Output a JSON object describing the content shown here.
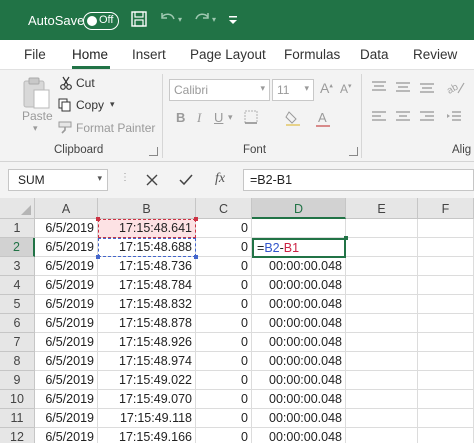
{
  "titlebar": {
    "autosave_label": "AutoSave",
    "autosave_state": "Off",
    "icons": [
      "save-icon",
      "undo-icon",
      "redo-icon",
      "customize-toolbar-icon"
    ],
    "color": "#217346"
  },
  "menu": {
    "tabs": [
      "File",
      "Home",
      "Insert",
      "Page Layout",
      "Formulas",
      "Data",
      "Review"
    ],
    "active": "Home"
  },
  "ribbon": {
    "clipboard": {
      "paste_label": "Paste",
      "cut_label": "Cut",
      "copy_label": "Copy",
      "format_painter_label": "Format Painter",
      "group_label": "Clipboard"
    },
    "font": {
      "font_name": "Calibri",
      "font_size": "11",
      "group_label": "Font"
    },
    "alignment": {
      "group_label": "Alig"
    }
  },
  "formula_bar": {
    "name_box": "SUM",
    "cancel_icon": "close-icon",
    "enter_icon": "check-icon",
    "function_label": "fx",
    "formula": "=B2-B1"
  },
  "sheet": {
    "columns": [
      "A",
      "B",
      "C",
      "D",
      "E",
      "F"
    ],
    "selected_column": "D",
    "selected_row": "2",
    "rows": [
      {
        "row": "1",
        "A": "6/5/2019",
        "B": "17:15:48.641",
        "C": "0",
        "D": ""
      },
      {
        "row": "2",
        "A": "6/5/2019",
        "B": "17:15:48.688",
        "C": "0",
        "D": "=B2-B1"
      },
      {
        "row": "3",
        "A": "6/5/2019",
        "B": "17:15:48.736",
        "C": "0",
        "D": "00:00:00.048"
      },
      {
        "row": "4",
        "A": "6/5/2019",
        "B": "17:15:48.784",
        "C": "0",
        "D": "00:00:00.048"
      },
      {
        "row": "5",
        "A": "6/5/2019",
        "B": "17:15:48.832",
        "C": "0",
        "D": "00:00:00.048"
      },
      {
        "row": "6",
        "A": "6/5/2019",
        "B": "17:15:48.878",
        "C": "0",
        "D": "00:00:00.048"
      },
      {
        "row": "7",
        "A": "6/5/2019",
        "B": "17:15:48.926",
        "C": "0",
        "D": "00:00:00.048"
      },
      {
        "row": "8",
        "A": "6/5/2019",
        "B": "17:15:48.974",
        "C": "0",
        "D": "00:00:00.048"
      },
      {
        "row": "9",
        "A": "6/5/2019",
        "B": "17:15:49.022",
        "C": "0",
        "D": "00:00:00.048"
      },
      {
        "row": "10",
        "A": "6/5/2019",
        "B": "17:15:49.070",
        "C": "0",
        "D": "00:00:00.048"
      },
      {
        "row": "11",
        "A": "6/5/2019",
        "B": "17:15:49.118",
        "C": "0",
        "D": "00:00:00.048"
      },
      {
        "row": "12",
        "A": "6/5/2019",
        "B": "17:15:49.166",
        "C": "0",
        "D": "00:00:00.048"
      }
    ],
    "edit_formula_parts": [
      "=",
      "B2",
      "-",
      "B1"
    ]
  }
}
